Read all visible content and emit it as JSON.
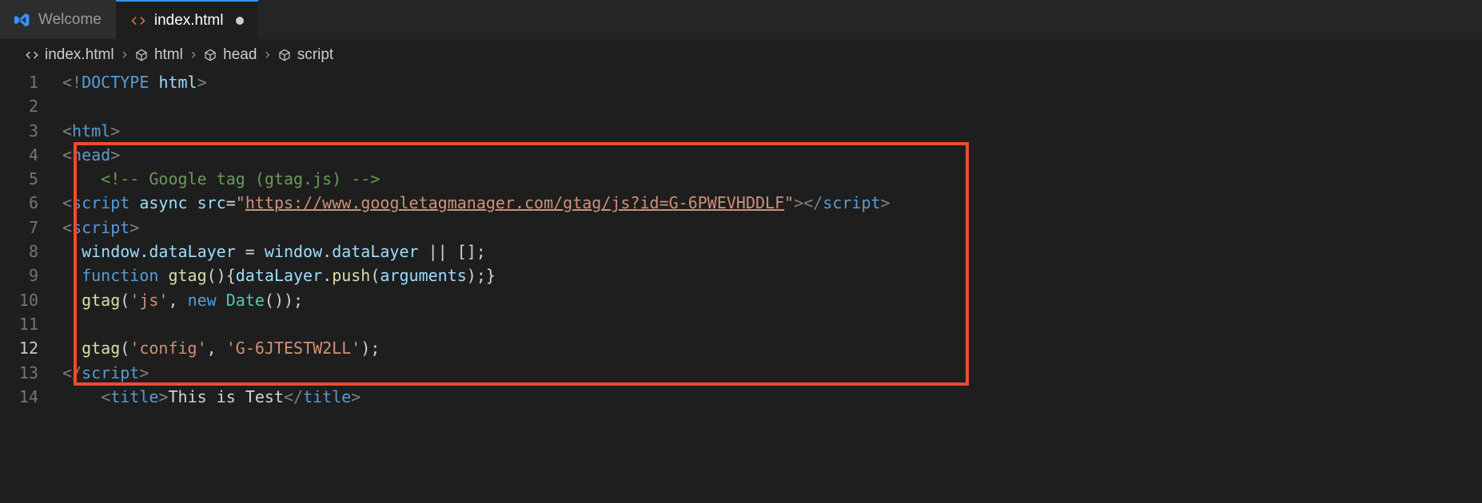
{
  "tabs": [
    {
      "label": "Welcome",
      "icon": "vscode"
    },
    {
      "label": "index.html",
      "icon": "code",
      "active": true,
      "dirty": true
    }
  ],
  "breadcrumb": [
    {
      "label": "index.html",
      "icon": "code"
    },
    {
      "label": "html",
      "icon": "cube"
    },
    {
      "label": "head",
      "icon": "cube"
    },
    {
      "label": "script",
      "icon": "cube"
    }
  ],
  "code": {
    "l1": {
      "t1": "<!",
      "t2": "DOCTYPE",
      "t3": " ",
      "t4": "html",
      "t5": ">"
    },
    "l3": {
      "t1": "<",
      "t2": "html",
      "t3": ">"
    },
    "l4": {
      "t1": "<",
      "t2": "head",
      "t3": ">"
    },
    "l5": {
      "t1": "<!-- Google tag (gtag.js) -->"
    },
    "l6": {
      "t1": "<",
      "t2": "script",
      "t3": " ",
      "t4": "async",
      "t5": " ",
      "t6": "src",
      "t7": "=",
      "t8": "\"",
      "t9": "https://www.googletagmanager.com/gtag/js?id=G-6PWEVHDDLF",
      "t10": "\"",
      "t11": "></",
      "t12": "script",
      "t13": ">"
    },
    "l7": {
      "t1": "<",
      "t2": "script",
      "t3": ">"
    },
    "l8": {
      "t1": "  ",
      "t2": "window",
      "t3": ".",
      "t4": "dataLayer",
      "t5": " = ",
      "t6": "window",
      "t7": ".",
      "t8": "dataLayer",
      "t9": " || [];"
    },
    "l9": {
      "t1": "  ",
      "t2": "function",
      "t3": " ",
      "t4": "gtag",
      "t5": "(){",
      "t6": "dataLayer",
      "t7": ".",
      "t8": "push",
      "t9": "(",
      "t10": "arguments",
      "t11": ");}"
    },
    "l10": {
      "t1": "  ",
      "t2": "gtag",
      "t3": "(",
      "t4": "'js'",
      "t5": ", ",
      "t6": "new",
      "t7": " ",
      "t8": "Date",
      "t9": "());"
    },
    "l12": {
      "t1": "  ",
      "t2": "gtag",
      "t3": "(",
      "t4": "'config'",
      "t5": ", ",
      "t6": "'G-6JTESTW2LL'",
      "t7": ");"
    },
    "l13": {
      "t1": "</",
      "t2": "script",
      "t3": ">"
    },
    "l14": {
      "t1": "<",
      "t2": "title",
      "t3": ">",
      "t4": "This is Test",
      "t5": "</",
      "t6": "title",
      "t7": ">"
    }
  },
  "lineNumbers": [
    "1",
    "2",
    "3",
    "4",
    "5",
    "6",
    "7",
    "8",
    "9",
    "10",
    "11",
    "12",
    "13",
    "14"
  ]
}
